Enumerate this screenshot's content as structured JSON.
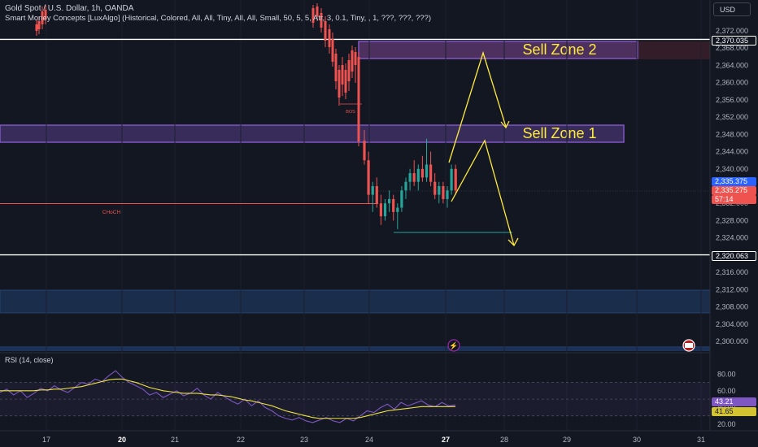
{
  "header": {
    "symbol_line": "Gold Spot / U.S. Dollar, 1h, OANDA",
    "indicator_line": "Smart Money Concepts [LuxAlgo] (Historical, Colored, All, All, Tiny, All, All, Small, 50, 5, 5, Atr, 3, 0.1, Tiny, , 1, ???, ???, ???)"
  },
  "currency_button": "USD",
  "rsi_title": "RSI (14, close)",
  "colors": {
    "background": "#131722",
    "bull": "#26a69a",
    "bear": "#ef5350",
    "zone_purple": "#7e57c2",
    "zone_blue": "#1e3a5f",
    "arrow_yellow": "#ffeb3b",
    "rsi_line": "#7e57c2",
    "rsi_ma": "#f0e442"
  },
  "chart_data": [
    {
      "type": "candlestick",
      "y_ticks": [
        2300,
        2304,
        2308,
        2312,
        2316,
        2320,
        2324,
        2328,
        2332,
        2336,
        2340,
        2344,
        2348,
        2352,
        2356,
        2360,
        2364,
        2368,
        2372
      ],
      "ylim": [
        2298,
        2375
      ],
      "x_ticks": [
        "17",
        "20",
        "21",
        "22",
        "23",
        "24",
        "27",
        "28",
        "29",
        "30",
        "31"
      ],
      "price_labels": {
        "resistance": "2,370.035",
        "support": "2,320.063",
        "last_price": "2,335.375",
        "current": "2,335.275",
        "countdown": "57:14"
      },
      "horizontal_levels": [
        {
          "value": 2370.035,
          "color": "#ffffff"
        },
        {
          "value": 2320.063,
          "color": "#ffffff"
        },
        {
          "value": 2332.5,
          "color": "#ef5350",
          "label": "CHoCH"
        }
      ],
      "zones": [
        {
          "label": "Sell Zone 2",
          "y_range": [
            2366.5,
            2370.0
          ],
          "color": "#7e57c2"
        },
        {
          "label": "Sell Zone 1",
          "y_range": [
            2346.5,
            2350.5
          ],
          "color": "#7e57c2"
        },
        {
          "label": "",
          "y_range": [
            2306.5,
            2311.8
          ],
          "color": "#1e3a5f"
        }
      ],
      "annotations": [
        "BOS",
        "CHoCH"
      ],
      "candles": [
        {
          "o": 2346.5,
          "h": 2349,
          "l": 2341,
          "c": 2342
        },
        {
          "o": 2342,
          "h": 2344,
          "l": 2332,
          "c": 2334
        },
        {
          "o": 2334,
          "h": 2337,
          "l": 2330,
          "c": 2336
        },
        {
          "o": 2336,
          "h": 2338,
          "l": 2331,
          "c": 2332
        },
        {
          "o": 2332,
          "h": 2334,
          "l": 2327,
          "c": 2329
        },
        {
          "o": 2329,
          "h": 2333,
          "l": 2328,
          "c": 2332
        },
        {
          "o": 2332,
          "h": 2335,
          "l": 2330,
          "c": 2333
        },
        {
          "o": 2333,
          "h": 2334,
          "l": 2328,
          "c": 2330
        },
        {
          "o": 2330,
          "h": 2332,
          "l": 2326,
          "c": 2331
        },
        {
          "o": 2331,
          "h": 2336,
          "l": 2330,
          "c": 2335
        },
        {
          "o": 2335,
          "h": 2338,
          "l": 2333,
          "c": 2337
        },
        {
          "o": 2337,
          "h": 2340,
          "l": 2335,
          "c": 2339
        },
        {
          "o": 2339,
          "h": 2342,
          "l": 2336,
          "c": 2337
        },
        {
          "o": 2337,
          "h": 2341,
          "l": 2335,
          "c": 2340
        },
        {
          "o": 2340,
          "h": 2343,
          "l": 2337,
          "c": 2338
        },
        {
          "o": 2338,
          "h": 2347,
          "l": 2337,
          "c": 2341
        },
        {
          "o": 2341,
          "h": 2344,
          "l": 2336,
          "c": 2337
        },
        {
          "o": 2337,
          "h": 2339,
          "l": 2333,
          "c": 2334
        },
        {
          "o": 2334,
          "h": 2337,
          "l": 2332,
          "c": 2336
        },
        {
          "o": 2336,
          "h": 2337,
          "l": 2332,
          "c": 2333
        },
        {
          "o": 2333,
          "h": 2336,
          "l": 2331,
          "c": 2335
        },
        {
          "o": 2335,
          "h": 2341,
          "l": 2334,
          "c": 2340
        },
        {
          "o": 2340,
          "h": 2341,
          "l": 2334,
          "c": 2335
        }
      ]
    },
    {
      "type": "line",
      "title": "RSI (14, close)",
      "y_ticks": [
        20,
        40,
        60,
        80
      ],
      "ylim": [
        18,
        90
      ],
      "labels": {
        "rsi": "43.21",
        "ma": "41.65"
      },
      "series": [
        {
          "values": [
            58,
            62,
            55,
            60,
            52,
            57,
            63,
            60,
            66,
            61,
            58,
            64,
            70,
            68,
            74,
            71,
            78,
            84,
            76,
            70,
            66,
            62,
            55,
            58,
            52,
            56,
            60,
            54,
            57,
            63,
            55,
            50,
            58,
            53,
            48,
            44,
            50,
            42,
            48,
            40,
            36,
            30,
            27,
            25,
            28,
            24,
            22,
            25,
            28,
            24,
            22,
            27,
            24,
            30,
            36,
            34,
            40,
            44,
            38,
            46,
            42,
            45,
            48,
            43,
            41,
            46,
            42,
            43
          ]
        },
        {
          "values": [
            60,
            60,
            60,
            60,
            60,
            60,
            61,
            61,
            62,
            62,
            63,
            64,
            65,
            67,
            69,
            71,
            73,
            74,
            74,
            72,
            70,
            67,
            64,
            62,
            60,
            59,
            58,
            57,
            57,
            57,
            56,
            55,
            55,
            54,
            53,
            51,
            49,
            48,
            46,
            44,
            42,
            39,
            36,
            34,
            32,
            30,
            28,
            27,
            27,
            27,
            27,
            27,
            27,
            28,
            30,
            32,
            34,
            36,
            37,
            38,
            39,
            40,
            41,
            41,
            41,
            41,
            41,
            41
          ]
        }
      ]
    }
  ]
}
